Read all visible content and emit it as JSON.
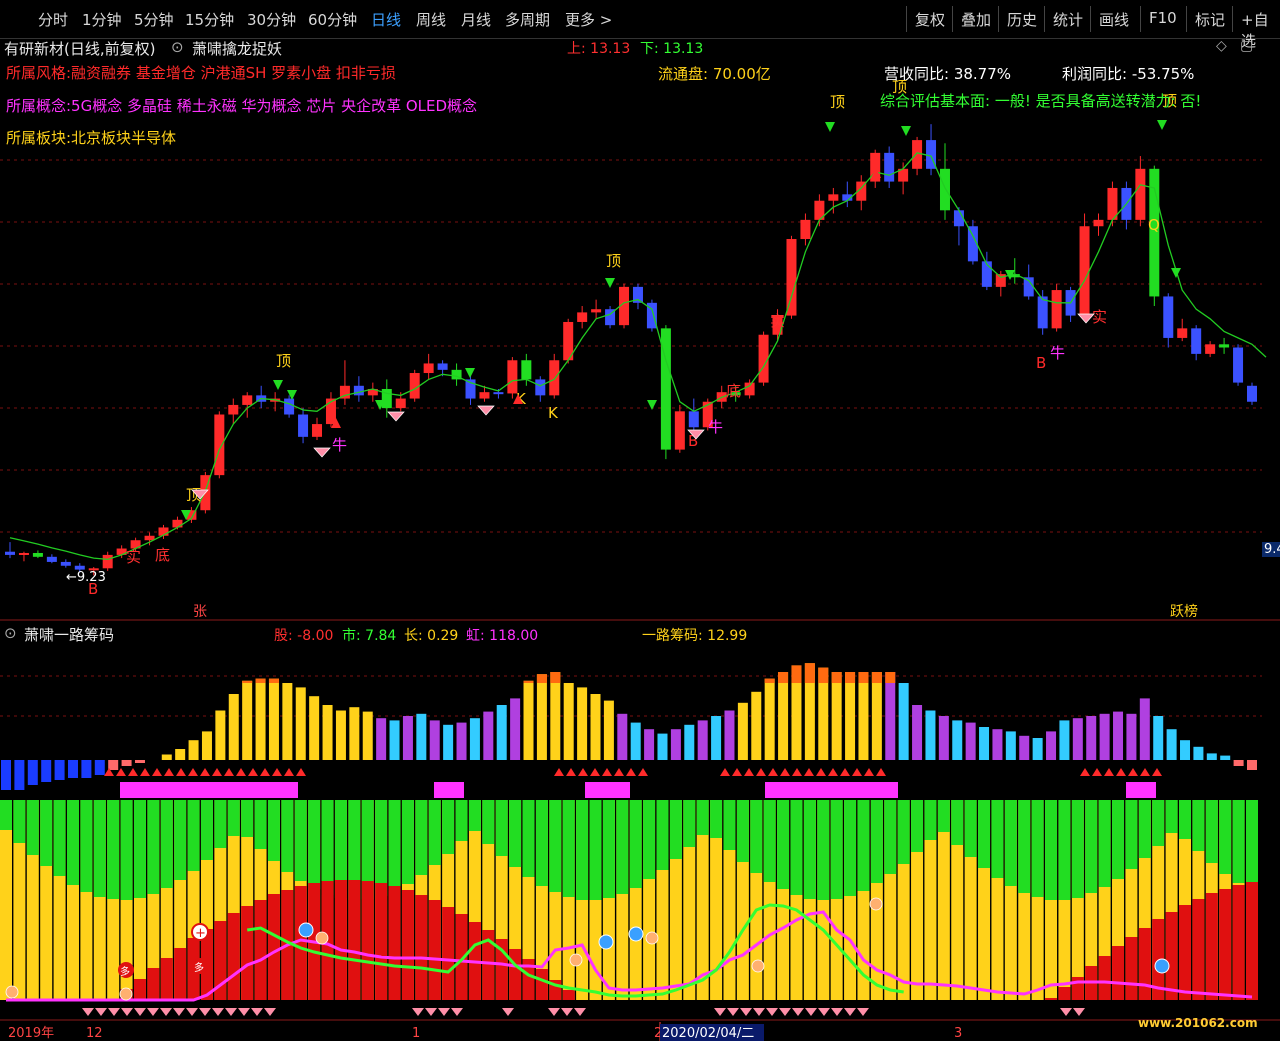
{
  "toolbar": {
    "left_tabs": [
      "分时",
      "1分钟",
      "5分钟",
      "15分钟",
      "30分钟",
      "60分钟",
      "日线",
      "周线",
      "月线",
      "多周期",
      "更多 >"
    ],
    "active_tab": "日线",
    "right_buttons": [
      "复权",
      "叠加",
      "历史",
      "统计",
      "画线",
      "F10",
      "标记",
      "+自选"
    ]
  },
  "header": {
    "stock_title": "有研新材(日线,前复权)",
    "indicator_name": "萧啸擒龙捉妖",
    "up_label": "上: 13.13",
    "down_label": "下: 13.13",
    "style_line": "所属风格:融资融券 基金增仓 沪港通SH 罗素小盘 扣非亏损",
    "concept_line": "所属概念:5G概念 多晶硅 稀土永磁 华为概念 芯片 央企改革 OLED概念",
    "sector_line": "所属板块:北京板块半导体",
    "float_cap": "流通盘: 70.00亿",
    "revenue_yoy": "营收同比: 38.77%",
    "profit_yoy": "利润同比: -53.75%",
    "assessment": "综合评估基本面: 一般! 是否具备高送转潜力: 否!",
    "price_tag": "9.4",
    "low_marker": "←9.23"
  },
  "annotations": {
    "ding": "顶",
    "di": "底",
    "shi": "实",
    "niu": "牛",
    "k": "K",
    "b": "B",
    "zhang": "张",
    "yuebang": "跃榜",
    "q": "Q"
  },
  "lower_panel": {
    "indicator_name": "萧啸一路筹码",
    "gu": "股: -8.00",
    "shi": "市: 7.84",
    "chang": "长: 0.29",
    "hong": "虹: 118.00",
    "yilu": "一路筹码: 12.99",
    "duo1": "多",
    "duo2": "多"
  },
  "x_axis": {
    "labels": [
      "2019年",
      "12",
      "1",
      "2",
      "2020/02/04/二",
      "3"
    ]
  },
  "watermark": "www.201062.com",
  "colors": {
    "up": "#ff2a2a",
    "down": "#3b52ff",
    "green": "#22dd22",
    "yellow": "#ffd21a",
    "magenta": "#ff33ff",
    "cyan": "#33ccff",
    "purple": "#b040e0",
    "orange": "#ff6a10",
    "grid": "#7a1010"
  },
  "chart_data": {
    "type": "candlestick",
    "candles": [
      {
        "o": 9.6,
        "h": 9.75,
        "l": 9.5,
        "c": 9.55
      },
      {
        "o": 9.55,
        "h": 9.6,
        "l": 9.45,
        "c": 9.58
      },
      {
        "o": 9.58,
        "h": 9.62,
        "l": 9.5,
        "c": 9.52
      },
      {
        "o": 9.52,
        "h": 9.56,
        "l": 9.42,
        "c": 9.44
      },
      {
        "o": 9.44,
        "h": 9.48,
        "l": 9.35,
        "c": 9.38
      },
      {
        "o": 9.38,
        "h": 9.42,
        "l": 9.28,
        "c": 9.32
      },
      {
        "o": 9.32,
        "h": 9.36,
        "l": 9.23,
        "c": 9.34
      },
      {
        "o": 9.34,
        "h": 9.6,
        "l": 9.3,
        "c": 9.55
      },
      {
        "o": 9.55,
        "h": 9.7,
        "l": 9.5,
        "c": 9.65
      },
      {
        "o": 9.65,
        "h": 9.82,
        "l": 9.6,
        "c": 9.78
      },
      {
        "o": 9.78,
        "h": 9.9,
        "l": 9.7,
        "c": 9.85
      },
      {
        "o": 9.85,
        "h": 10.02,
        "l": 9.8,
        "c": 9.98
      },
      {
        "o": 9.98,
        "h": 10.15,
        "l": 9.95,
        "c": 10.1
      },
      {
        "o": 10.1,
        "h": 10.3,
        "l": 10.05,
        "c": 10.25
      },
      {
        "o": 10.25,
        "h": 10.85,
        "l": 10.2,
        "c": 10.8
      },
      {
        "o": 10.8,
        "h": 11.8,
        "l": 10.75,
        "c": 11.75
      },
      {
        "o": 11.75,
        "h": 12.0,
        "l": 11.6,
        "c": 11.9
      },
      {
        "o": 11.9,
        "h": 12.1,
        "l": 11.7,
        "c": 12.05
      },
      {
        "o": 12.05,
        "h": 12.2,
        "l": 11.85,
        "c": 11.95
      },
      {
        "o": 11.95,
        "h": 12.1,
        "l": 11.8,
        "c": 12.0
      },
      {
        "o": 12.0,
        "h": 12.05,
        "l": 11.7,
        "c": 11.75
      },
      {
        "o": 11.75,
        "h": 11.85,
        "l": 11.3,
        "c": 11.4
      },
      {
        "o": 11.4,
        "h": 11.7,
        "l": 11.35,
        "c": 11.6
      },
      {
        "o": 11.6,
        "h": 12.1,
        "l": 11.55,
        "c": 12.0
      },
      {
        "o": 12.0,
        "h": 12.6,
        "l": 11.9,
        "c": 12.2
      },
      {
        "o": 12.2,
        "h": 12.35,
        "l": 11.95,
        "c": 12.05
      },
      {
        "o": 12.05,
        "h": 12.25,
        "l": 11.95,
        "c": 12.15
      },
      {
        "o": 12.15,
        "h": 12.3,
        "l": 11.7,
        "c": 11.85
      },
      {
        "o": 11.85,
        "h": 12.1,
        "l": 11.8,
        "c": 12.0
      },
      {
        "o": 12.0,
        "h": 12.45,
        "l": 11.95,
        "c": 12.4
      },
      {
        "o": 12.4,
        "h": 12.7,
        "l": 12.3,
        "c": 12.55
      },
      {
        "o": 12.55,
        "h": 12.6,
        "l": 12.35,
        "c": 12.45
      },
      {
        "o": 12.45,
        "h": 12.55,
        "l": 12.2,
        "c": 12.3
      },
      {
        "o": 12.3,
        "h": 12.4,
        "l": 11.9,
        "c": 12.0
      },
      {
        "o": 12.0,
        "h": 12.2,
        "l": 11.95,
        "c": 12.1
      },
      {
        "o": 12.1,
        "h": 12.15,
        "l": 12.0,
        "c": 12.08
      },
      {
        "o": 12.08,
        "h": 12.65,
        "l": 12.0,
        "c": 12.6
      },
      {
        "o": 12.6,
        "h": 12.7,
        "l": 12.2,
        "c": 12.3
      },
      {
        "o": 12.3,
        "h": 12.35,
        "l": 11.95,
        "c": 12.05
      },
      {
        "o": 12.05,
        "h": 12.7,
        "l": 12.0,
        "c": 12.6
      },
      {
        "o": 12.6,
        "h": 13.25,
        "l": 12.55,
        "c": 13.2
      },
      {
        "o": 13.2,
        "h": 13.45,
        "l": 13.1,
        "c": 13.35
      },
      {
        "o": 13.35,
        "h": 13.55,
        "l": 13.25,
        "c": 13.4
      },
      {
        "o": 13.4,
        "h": 13.45,
        "l": 13.1,
        "c": 13.15
      },
      {
        "o": 13.15,
        "h": 13.8,
        "l": 13.1,
        "c": 13.75
      },
      {
        "o": 13.75,
        "h": 13.8,
        "l": 13.4,
        "c": 13.5
      },
      {
        "o": 13.5,
        "h": 13.55,
        "l": 13.05,
        "c": 13.1
      },
      {
        "o": 13.1,
        "h": 13.15,
        "l": 11.05,
        "c": 11.2
      },
      {
        "o": 11.2,
        "h": 11.9,
        "l": 11.15,
        "c": 11.8
      },
      {
        "o": 11.8,
        "h": 12.0,
        "l": 11.5,
        "c": 11.55
      },
      {
        "o": 11.55,
        "h": 12.0,
        "l": 11.5,
        "c": 11.95
      },
      {
        "o": 11.95,
        "h": 12.2,
        "l": 11.85,
        "c": 12.1
      },
      {
        "o": 12.1,
        "h": 12.2,
        "l": 11.95,
        "c": 12.05
      },
      {
        "o": 12.05,
        "h": 12.3,
        "l": 12.0,
        "c": 12.25
      },
      {
        "o": 12.25,
        "h": 13.05,
        "l": 12.2,
        "c": 13.0
      },
      {
        "o": 13.0,
        "h": 13.4,
        "l": 12.9,
        "c": 13.3
      },
      {
        "o": 13.3,
        "h": 14.55,
        "l": 13.25,
        "c": 14.5
      },
      {
        "o": 14.5,
        "h": 14.9,
        "l": 14.4,
        "c": 14.8
      },
      {
        "o": 14.8,
        "h": 15.2,
        "l": 14.7,
        "c": 15.1
      },
      {
        "o": 15.1,
        "h": 15.3,
        "l": 14.9,
        "c": 15.2
      },
      {
        "o": 15.2,
        "h": 15.4,
        "l": 15.0,
        "c": 15.1
      },
      {
        "o": 15.1,
        "h": 15.5,
        "l": 14.95,
        "c": 15.4
      },
      {
        "o": 15.4,
        "h": 15.9,
        "l": 15.3,
        "c": 15.85
      },
      {
        "o": 15.85,
        "h": 15.95,
        "l": 15.3,
        "c": 15.4
      },
      {
        "o": 15.4,
        "h": 15.7,
        "l": 15.2,
        "c": 15.6
      },
      {
        "o": 15.6,
        "h": 16.1,
        "l": 15.5,
        "c": 16.05
      },
      {
        "o": 16.05,
        "h": 16.3,
        "l": 15.5,
        "c": 15.6
      },
      {
        "o": 15.6,
        "h": 16.0,
        "l": 14.8,
        "c": 14.95
      },
      {
        "o": 14.95,
        "h": 15.0,
        "l": 14.4,
        "c": 14.7
      },
      {
        "o": 14.7,
        "h": 14.8,
        "l": 14.1,
        "c": 14.15
      },
      {
        "o": 14.15,
        "h": 14.3,
        "l": 13.7,
        "c": 13.75
      },
      {
        "o": 13.75,
        "h": 14.0,
        "l": 13.6,
        "c": 13.95
      },
      {
        "o": 13.95,
        "h": 14.2,
        "l": 13.8,
        "c": 13.9
      },
      {
        "o": 13.9,
        "h": 14.1,
        "l": 13.55,
        "c": 13.6
      },
      {
        "o": 13.6,
        "h": 13.7,
        "l": 13.0,
        "c": 13.1
      },
      {
        "o": 13.1,
        "h": 13.8,
        "l": 13.05,
        "c": 13.7
      },
      {
        "o": 13.7,
        "h": 13.75,
        "l": 13.2,
        "c": 13.3
      },
      {
        "o": 13.3,
        "h": 14.9,
        "l": 13.25,
        "c": 14.7
      },
      {
        "o": 14.7,
        "h": 14.9,
        "l": 14.55,
        "c": 14.8
      },
      {
        "o": 14.8,
        "h": 15.4,
        "l": 14.7,
        "c": 15.3
      },
      {
        "o": 15.3,
        "h": 15.4,
        "l": 14.65,
        "c": 14.8
      },
      {
        "o": 14.8,
        "h": 15.8,
        "l": 14.7,
        "c": 15.6
      },
      {
        "o": 15.6,
        "h": 15.65,
        "l": 13.45,
        "c": 13.6
      },
      {
        "o": 13.6,
        "h": 13.65,
        "l": 12.8,
        "c": 12.95
      },
      {
        "o": 12.95,
        "h": 13.25,
        "l": 12.9,
        "c": 13.1
      },
      {
        "o": 13.1,
        "h": 13.15,
        "l": 12.6,
        "c": 12.7
      },
      {
        "o": 12.7,
        "h": 12.9,
        "l": 12.65,
        "c": 12.85
      },
      {
        "o": 12.85,
        "h": 12.95,
        "l": 12.7,
        "c": 12.8
      },
      {
        "o": 12.8,
        "h": 12.85,
        "l": 12.2,
        "c": 12.25
      },
      {
        "o": 12.2,
        "h": 12.25,
        "l": 11.9,
        "c": 11.95
      }
    ],
    "trend_line": [
      9.82,
      9.77,
      9.72,
      9.66,
      9.61,
      9.55,
      9.5,
      9.48,
      9.55,
      9.65,
      9.75,
      9.86,
      9.98,
      10.12,
      10.55,
      11.2,
      11.6,
      11.85,
      12.0,
      11.98,
      11.92,
      11.82,
      11.8,
      11.95,
      12.05,
      12.1,
      12.15,
      12.08,
      12.05,
      12.15,
      12.3,
      12.38,
      12.35,
      12.25,
      12.18,
      12.12,
      12.28,
      12.3,
      12.2,
      12.3,
      12.6,
      12.95,
      13.25,
      13.32,
      13.5,
      13.55,
      13.4,
      12.6,
      11.95,
      11.8,
      11.9,
      12.02,
      12.1,
      12.2,
      12.5,
      12.9,
      13.6,
      14.3,
      14.8,
      15.0,
      15.1,
      15.3,
      15.55,
      15.5,
      15.6,
      15.85,
      15.8,
      15.3,
      14.95,
      14.55,
      14.1,
      13.9,
      13.95,
      13.85,
      13.55,
      13.5,
      13.5,
      13.85,
      14.3,
      14.8,
      15.05,
      15.35,
      15.3,
      14.4,
      13.7,
      13.4,
      13.25,
      13.05,
      12.95,
      12.85,
      12.65
    ],
    "yrange": [
      9.0,
      16.6
    ],
    "chip_bars": [
      -30,
      -30,
      -25,
      -22,
      -20,
      -18,
      -18,
      -15,
      -10,
      -6,
      -3,
      0,
      5,
      10,
      18,
      26,
      45,
      60,
      72,
      74,
      74,
      70,
      66,
      58,
      50,
      45,
      48,
      44,
      38,
      36,
      40,
      42,
      36,
      32,
      34,
      38,
      44,
      50,
      56,
      72,
      78,
      80,
      70,
      66,
      60,
      54,
      42,
      34,
      28,
      24,
      28,
      32,
      36,
      40,
      45,
      52,
      62,
      74,
      80,
      86,
      88,
      84,
      80,
      80,
      80,
      80,
      80,
      70,
      50,
      45,
      40,
      36,
      34,
      30,
      28,
      26,
      22,
      20,
      26,
      36,
      38,
      40,
      42,
      44,
      42,
      56,
      40,
      28,
      18,
      12,
      6,
      4,
      -6,
      -10
    ]
  }
}
